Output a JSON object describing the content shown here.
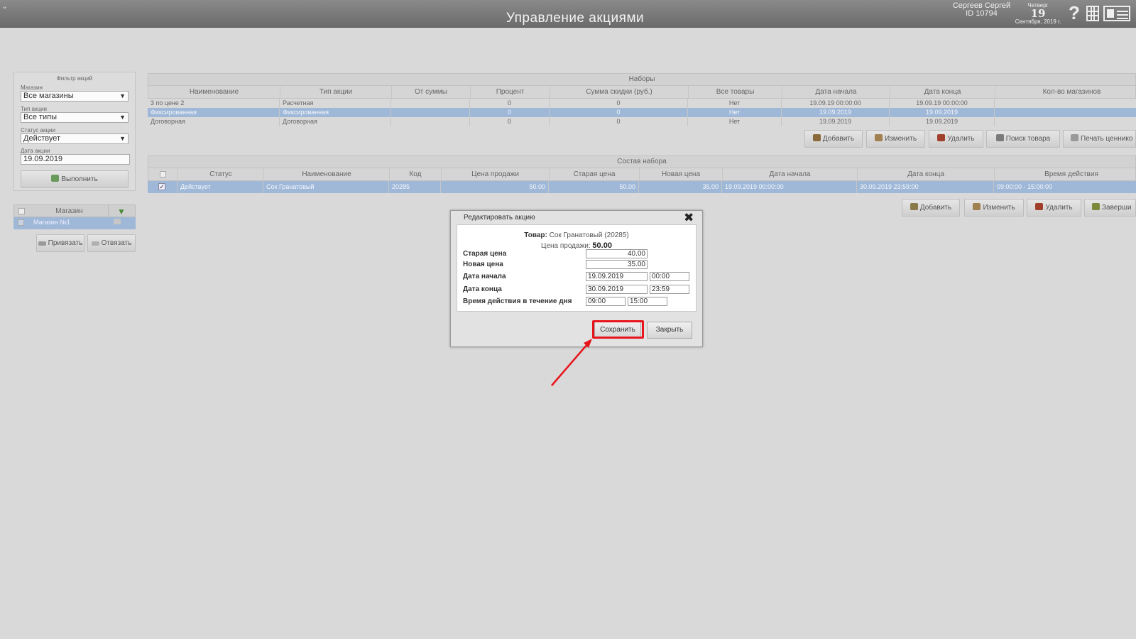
{
  "header": {
    "title": "Управление акциями",
    "user_name": "Сергеев Сергей",
    "user_id": "ID 10794",
    "weekday": "Четверг",
    "day": "19",
    "month_year": "Сентября, 2019 г.",
    "help_glyph": "?"
  },
  "filter": {
    "title": "Фильтр акций",
    "shop_label": "Магазин",
    "shop_value": "Все магазины",
    "type_label": "Тип акции",
    "type_value": "Все типы",
    "status_label": "Статус акции",
    "status_value": "Действует",
    "date_label": "Дата акции",
    "date_value": "19.09.2019",
    "run_button": "Выполнить"
  },
  "shops": {
    "header": "Магазин",
    "rows": [
      {
        "name": "Магазин №1"
      }
    ],
    "bind_button": "Привязать",
    "unbind_button": "Отвязать"
  },
  "sets": {
    "caption": "Наборы",
    "columns": [
      "Наименование",
      "Тип акции",
      "От суммы",
      "Процент",
      "Сумма скидки (руб.)",
      "Все товары",
      "Дата начала",
      "Дата конца",
      "Кол-во магазинов"
    ],
    "rows": [
      {
        "name": "3 по цене 2",
        "type": "Расчетная",
        "from_sum": "",
        "percent": "0",
        "discount": "0",
        "all_goods": "Нет",
        "start": "19.09.19 00:00:00",
        "end": "19.09.19 00:00:00",
        "shops": "",
        "selected": false
      },
      {
        "name": "Фиксированная",
        "type": "Фиксированная",
        "from_sum": "",
        "percent": "0",
        "discount": "0",
        "all_goods": "Нет",
        "start": "19.09.2019",
        "end": "19.09.2019",
        "shops": "",
        "selected": true
      },
      {
        "name": "Договорная",
        "type": "Договорная",
        "from_sum": "",
        "percent": "0",
        "discount": "0",
        "all_goods": "Нет",
        "start": "19.09.2019",
        "end": "19.09.2019",
        "shops": "",
        "selected": false
      }
    ],
    "buttons": {
      "add": "Добавить",
      "edit": "Изменить",
      "delete": "Удалить",
      "search": "Поиск товара",
      "print": "Печать ценнико"
    }
  },
  "composition": {
    "caption": "Состав набора",
    "columns": [
      "Статус",
      "Наименование",
      "Код",
      "Цена продажи",
      "Старая цена",
      "Новая цена",
      "Дата начала",
      "Дата конца",
      "Время действия"
    ],
    "rows": [
      {
        "status": "Действует",
        "name": "Сок Гранатовый",
        "code": "20285",
        "sale_price": "50.00",
        "old_price": "50.00",
        "new_price": "35.00",
        "start": "19.09.2019 00:00:00",
        "end": "30.09.2019 23:59:00",
        "time": "09:00:00 - 15:00:00",
        "selected": true
      }
    ],
    "buttons": {
      "add": "Добавить",
      "edit": "Изменить",
      "delete": "Удалить",
      "finish": "Заверши"
    }
  },
  "modal": {
    "title": "Редактировать акцию",
    "product_label": "Товар:",
    "product_value": "Сок Гранатовый (20285)",
    "sale_price_label": "Цена продажи:",
    "sale_price_value": "50.00",
    "old_price_label": "Старая цена",
    "old_price_value": "40.00",
    "new_price_label": "Новая цена",
    "new_price_value": "35.00",
    "start_label": "Дата начала",
    "start_date": "19.09.2019",
    "start_time": "00:00",
    "end_label": "Дата конца",
    "end_date": "30.09.2019",
    "end_time": "23:59",
    "daily_label": "Время действия в течение дня",
    "daily_from": "09:00",
    "daily_to": "15:00",
    "save_button": "Сохранить",
    "close_button": "Закрыть"
  },
  "colors": {
    "highlight": "#e8141b",
    "selected_row": "#9fb8d8",
    "header_bar": "#737373"
  }
}
